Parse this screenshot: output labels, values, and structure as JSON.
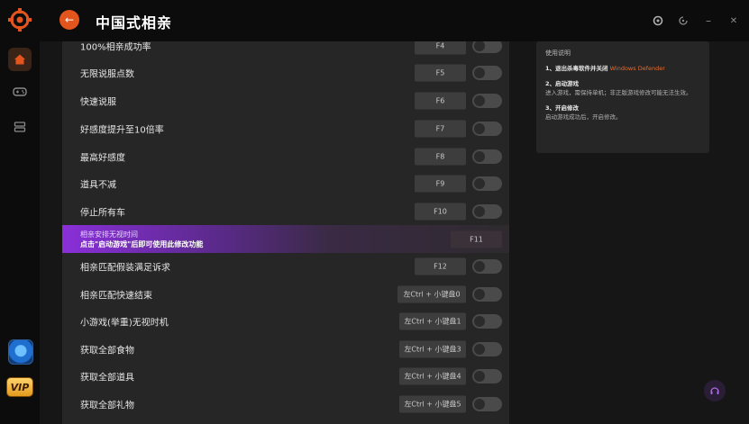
{
  "header": {
    "title": "中国式相亲"
  },
  "cheats": [
    {
      "label": "100%相亲成功率",
      "key": "F4"
    },
    {
      "label": "无限说服点数",
      "key": "F5"
    },
    {
      "label": "快速说服",
      "key": "F6"
    },
    {
      "label": "好感度提升至10倍率",
      "key": "F7"
    },
    {
      "label": "最高好感度",
      "key": "F8"
    },
    {
      "label": "道具不减",
      "key": "F9"
    },
    {
      "label": "停止所有车",
      "key": "F10"
    },
    {
      "label": "相亲安排无视时间",
      "sublabel": "点击\"启动游戏\"后即可使用此修改功能",
      "key": "F11",
      "highlighted": true
    },
    {
      "label": "相亲匹配假装满足诉求",
      "key": "F12"
    },
    {
      "label": "相亲匹配快速结束",
      "key": "左Ctrl + 小键盘0"
    },
    {
      "label": "小游戏(举重)无视时机",
      "key": "左Ctrl + 小键盘1"
    },
    {
      "label": "获取全部食物",
      "key": "左Ctrl + 小键盘3"
    },
    {
      "label": "获取全部道具",
      "key": "左Ctrl + 小键盘4"
    },
    {
      "label": "获取全部礼物",
      "key": "左Ctrl + 小键盘5"
    }
  ],
  "info": {
    "title": "使用说明",
    "step1_heading": "1、退出杀毒软件并关闭",
    "step1_highlight": "Windows Defender",
    "step2_heading": "2、启动游戏",
    "step2_body": "进入游戏，需保持单机；非正版游戏修改可能无法生效。",
    "step3_heading": "3、开启修改",
    "step3_body": "启动游戏成功后，开启修改。"
  },
  "sidebar": {
    "vip_label": "VIP"
  },
  "icons": [
    "logo-icon",
    "back-arrow-icon",
    "home-icon",
    "gamepad-icon",
    "layers-icon",
    "settings-icon",
    "minimize-icon",
    "close-icon",
    "headset-icon"
  ],
  "colors": {
    "accent": "#e4541d",
    "highlight": "#8a2fd9",
    "background": "#161616"
  }
}
